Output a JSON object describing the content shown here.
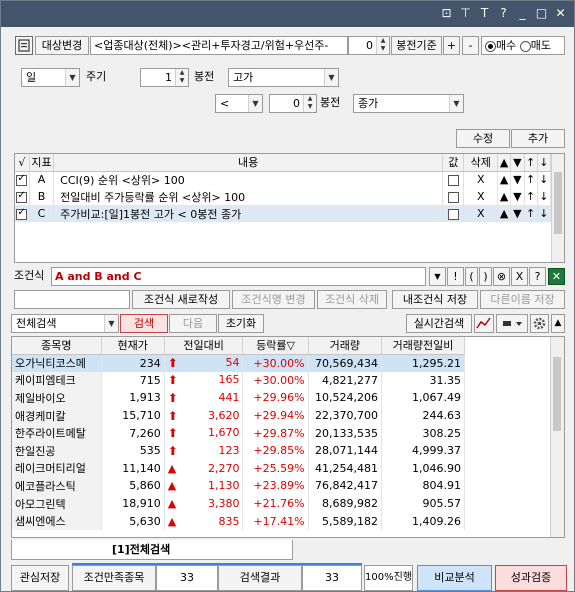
{
  "titlebar": {
    "icons": [
      "⊡",
      "⊤",
      "T",
      "?",
      "_",
      "□",
      "✕"
    ]
  },
  "toolbar": {
    "target_change": "대상변경",
    "target_text": "<업종대상(전체)><관리+투자경고/위험+우선주-",
    "count_value": "0",
    "basis_label": "봉전기준",
    "plus": "+",
    "minus": "-",
    "buy_label": "매수",
    "sell_label": "매도"
  },
  "condition": {
    "period_value": "일",
    "period_label": "주기",
    "bar1_value": "1",
    "bar1_label": "봉전",
    "price1_value": "고가",
    "compare_value": "<",
    "bar2_value": "0",
    "bar2_label": "봉전",
    "price2_value": "종가",
    "modify": "수정",
    "add": "추가"
  },
  "cond_table": {
    "headers": [
      "√",
      "지표",
      "내용",
      "값",
      "삭제",
      "▲",
      "▼",
      "↑",
      "↓"
    ],
    "rows": [
      {
        "key": "A",
        "content": "CCI(9) 순위 <상위> 100",
        "del": "X",
        "up": "▲",
        "down": "▼",
        "top": "↑",
        "bot": "↓"
      },
      {
        "key": "B",
        "content": "전일대비 주가등락률 순위 <상위> 100",
        "del": "X",
        "up": "▲",
        "down": "▼",
        "top": "↑",
        "bot": "↓"
      },
      {
        "key": "C",
        "content": "주가비교:[일]1봉전 고가 < 0봉전 종가",
        "del": "X",
        "up": "▲",
        "down": "▼",
        "top": "↑",
        "bot": "↓"
      }
    ]
  },
  "formula": {
    "label": "조건식",
    "value": "A and B and C",
    "symbols": [
      "▼",
      "!",
      "(",
      ")",
      "⊗",
      "X",
      "?"
    ]
  },
  "formula_buttons": {
    "new": "조건식 새로작성",
    "rename": "조건식명 변경",
    "delete": "조건식 삭제",
    "save_mine": "내조건식 저장",
    "save_as": "다른이름 저장"
  },
  "search_bar": {
    "scope": "전체검색",
    "search": "검색",
    "next": "다음",
    "reset": "초기화",
    "realtime": "실시간검색"
  },
  "results": {
    "headers": [
      "종목명",
      "현재가",
      "전일대비",
      "등락률▽",
      "거래량",
      "거래량전일비"
    ],
    "rows": [
      {
        "name": "오가닉티코스메",
        "price": "234",
        "mark": "up",
        "change": "54",
        "rate": "+30.00%",
        "volume": "70,569,434",
        "ratio": "1,295.21"
      },
      {
        "name": "케이피엠테크",
        "price": "715",
        "mark": "up",
        "change": "165",
        "rate": "+30.00%",
        "volume": "4,821,277",
        "ratio": "31.35"
      },
      {
        "name": "제일바이오",
        "price": "1,913",
        "mark": "up",
        "change": "441",
        "rate": "+29.96%",
        "volume": "10,524,206",
        "ratio": "1,067.49"
      },
      {
        "name": "애경케미칼",
        "price": "15,710",
        "mark": "up",
        "change": "3,620",
        "rate": "+29.94%",
        "volume": "22,370,700",
        "ratio": "244.63"
      },
      {
        "name": "한주라이트메탈",
        "price": "7,260",
        "mark": "up",
        "change": "1,670",
        "rate": "+29.87%",
        "volume": "20,133,535",
        "ratio": "308.25"
      },
      {
        "name": "한일진공",
        "price": "535",
        "mark": "up",
        "change": "123",
        "rate": "+29.85%",
        "volume": "28,071,144",
        "ratio": "4,999.37"
      },
      {
        "name": "레이크머티리얼",
        "price": "11,140",
        "mark": "rise",
        "change": "2,270",
        "rate": "+25.59%",
        "volume": "41,254,481",
        "ratio": "1,046.90"
      },
      {
        "name": "에코플라스틱",
        "price": "5,860",
        "mark": "rise",
        "change": "1,130",
        "rate": "+23.89%",
        "volume": "76,842,417",
        "ratio": "804.91"
      },
      {
        "name": "아모그린텍",
        "price": "18,910",
        "mark": "rise",
        "change": "3,380",
        "rate": "+21.76%",
        "volume": "8,689,982",
        "ratio": "905.57"
      },
      {
        "name": "샘씨엔에스",
        "price": "5,630",
        "mark": "rise",
        "change": "835",
        "rate": "+17.41%",
        "volume": "5,589,182",
        "ratio": "1,409.26"
      }
    ]
  },
  "tab": {
    "label": "[1]전체검색"
  },
  "bottom": {
    "save_interest": "관심저장",
    "match_label": "조건만족종목",
    "match_count": "33",
    "result_label": "검색결과",
    "result_count": "33",
    "progress_text": "100%진행",
    "progress": 1.0,
    "compare": "비교분석",
    "verify": "성과검증"
  },
  "colors": {
    "title_bar": "#44546a",
    "up_red": "#e00000",
    "search_btn_bg": "#fbe3e3",
    "selected_row": "#cfe3f7",
    "progress_blue": "#3d82d8",
    "compare_bg": "#cfe4fb",
    "verify_bg": "#fcdcdc"
  }
}
